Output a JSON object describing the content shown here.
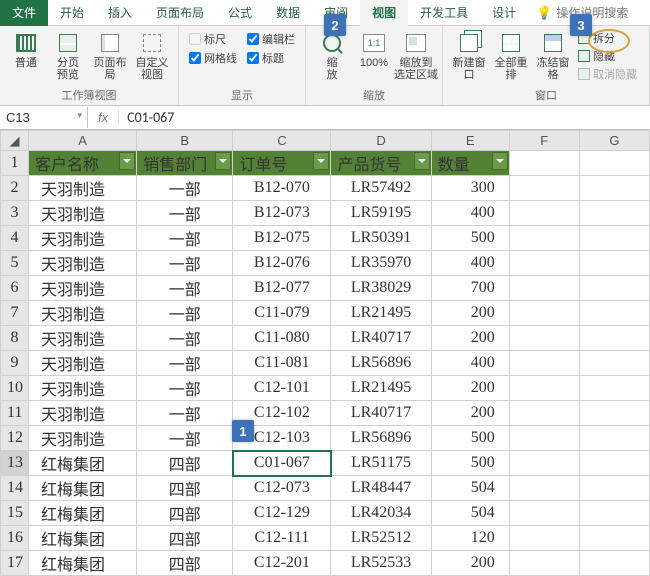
{
  "tabs": {
    "file": "文件",
    "home": "开始",
    "insert": "插入",
    "pagelayout": "页面布局",
    "formulas": "公式",
    "data": "数据",
    "review": "审阅",
    "view": "视图",
    "developer": "开发工具",
    "design": "设计",
    "tellme": "操作说明搜索"
  },
  "ribbon": {
    "wbviews": {
      "normal": "普通",
      "pgbreak": "分页\n预览",
      "pagelayout": "页面布局",
      "custom": "自定义视图",
      "group": "工作簿视图"
    },
    "show": {
      "ruler": "标尺",
      "formulabar": "编辑栏",
      "gridlines": "网格线",
      "headings": "标题",
      "group": "显示"
    },
    "zoom": {
      "zoom": "缩\n放",
      "p100": "100%",
      "tosel": "缩放到\n选定区域",
      "group": "缩放"
    },
    "window": {
      "newwin": "新建窗口",
      "arrange": "全部重排",
      "freeze": "冻结窗格",
      "split": "拆分",
      "hide": "隐藏",
      "unhide": "取消隐藏",
      "group": "窗口"
    }
  },
  "badges": {
    "b1": "1",
    "b2": "2",
    "b3": "3"
  },
  "namebox": "C13",
  "fx": "fx",
  "formula": "C01-067",
  "cols": [
    "A",
    "B",
    "C",
    "D",
    "E",
    "F",
    "G"
  ],
  "headers": [
    "客户名称",
    "销售部门",
    "订单号",
    "产品货号",
    "数量"
  ],
  "rows": [
    {
      "n": 2,
      "a": "天羽制造",
      "b": "一部",
      "c": "B12-070",
      "d": "LR57492",
      "e": 300
    },
    {
      "n": 3,
      "a": "天羽制造",
      "b": "一部",
      "c": "B12-073",
      "d": "LR59195",
      "e": 400
    },
    {
      "n": 4,
      "a": "天羽制造",
      "b": "一部",
      "c": "B12-075",
      "d": "LR50391",
      "e": 500
    },
    {
      "n": 5,
      "a": "天羽制造",
      "b": "一部",
      "c": "B12-076",
      "d": "LR35970",
      "e": 400
    },
    {
      "n": 6,
      "a": "天羽制造",
      "b": "一部",
      "c": "B12-077",
      "d": "LR38029",
      "e": 700
    },
    {
      "n": 7,
      "a": "天羽制造",
      "b": "一部",
      "c": "C11-079",
      "d": "LR21495",
      "e": 200
    },
    {
      "n": 8,
      "a": "天羽制造",
      "b": "一部",
      "c": "C11-080",
      "d": "LR40717",
      "e": 200
    },
    {
      "n": 9,
      "a": "天羽制造",
      "b": "一部",
      "c": "C11-081",
      "d": "LR56896",
      "e": 400
    },
    {
      "n": 10,
      "a": "天羽制造",
      "b": "一部",
      "c": "C12-101",
      "d": "LR21495",
      "e": 200
    },
    {
      "n": 11,
      "a": "天羽制造",
      "b": "一部",
      "c": "C12-102",
      "d": "LR40717",
      "e": 200
    },
    {
      "n": 12,
      "a": "天羽制造",
      "b": "一部",
      "c": "C12-103",
      "d": "LR56896",
      "e": 500
    },
    {
      "n": 13,
      "a": "红梅集团",
      "b": "四部",
      "c": "C01-067",
      "d": "LR51175",
      "e": 500
    },
    {
      "n": 14,
      "a": "红梅集团",
      "b": "四部",
      "c": "C12-073",
      "d": "LR48447",
      "e": 504
    },
    {
      "n": 15,
      "a": "红梅集团",
      "b": "四部",
      "c": "C12-129",
      "d": "LR42034",
      "e": 504
    },
    {
      "n": 16,
      "a": "红梅集团",
      "b": "四部",
      "c": "C12-111",
      "d": "LR52512",
      "e": 120
    },
    {
      "n": 17,
      "a": "红梅集团",
      "b": "四部",
      "c": "C12-201",
      "d": "LR52533",
      "e": 200
    }
  ]
}
